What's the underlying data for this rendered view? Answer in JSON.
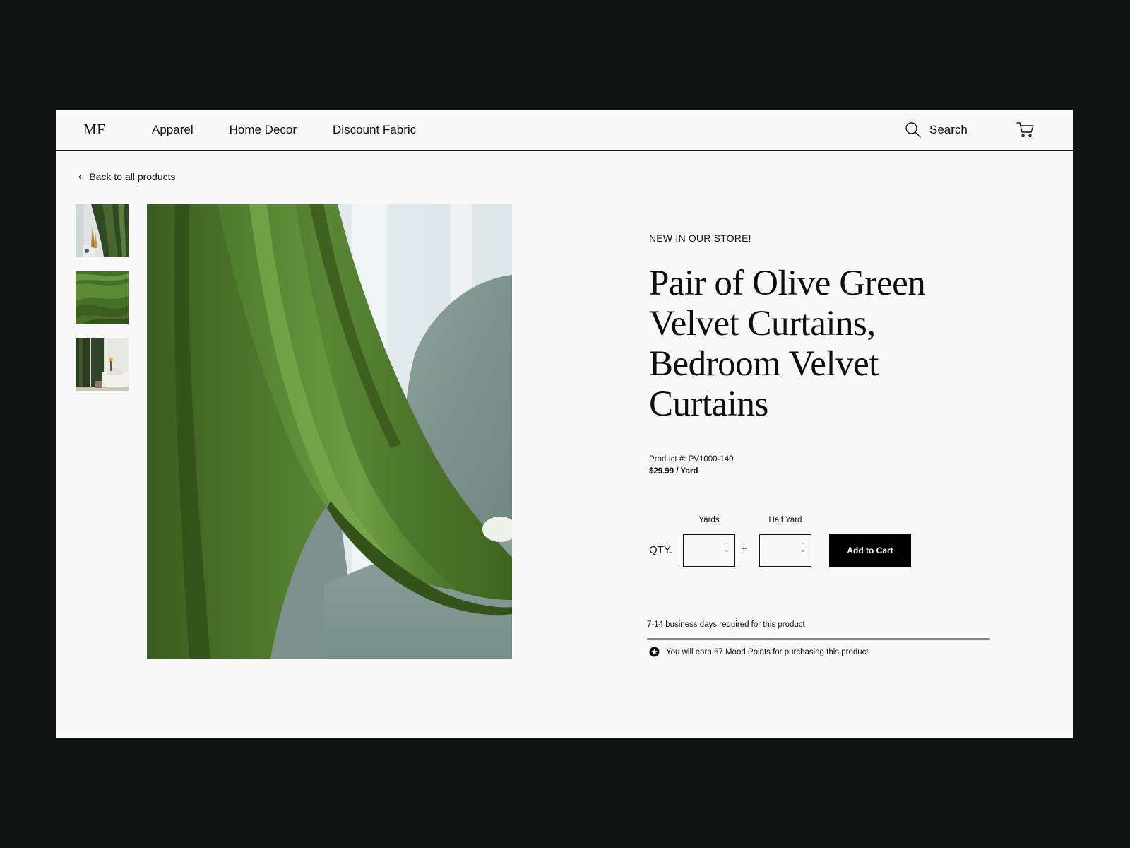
{
  "header": {
    "logo": "MF",
    "nav": [
      {
        "label": "Apparel"
      },
      {
        "label": "Home Decor"
      },
      {
        "label": "Discount Fabric"
      }
    ],
    "search_label": "Search",
    "icons": {
      "search": "search-icon",
      "cart": "cart-icon"
    }
  },
  "back_link": {
    "label": "Back to all products"
  },
  "gallery": {
    "thumbnails": [
      "curtain-room-photo",
      "velvet-fabric-closeup",
      "curtain-living-room-photo"
    ],
    "main_image": "olive-velvet-curtain-draped-over-armchair"
  },
  "product": {
    "badge": "NEW IN OUR STORE!",
    "title": "Pair of Olive Green Velvet Curtains, Bedroom Velvet Curtains",
    "sku": "Product #: PV1000-140",
    "price": "$29.99 / Yard"
  },
  "purchase": {
    "qty_label": "QTY.",
    "yards_caption": "Yards",
    "yards_value": "",
    "half_yard_caption": "Half Yard",
    "half_yard_value": "",
    "plus": "+",
    "add_to_cart": "Add to Cart"
  },
  "shipping": {
    "lead_time": "7-14 business days required for this product",
    "points": "You will earn 67 Mood Points for purchasing this product."
  },
  "colors": {
    "page_bg": "#f8f8f8",
    "outer_bg": "#111212",
    "button": "#000000",
    "velvet_green": "#4e7a2c",
    "chair_gray": "#7f9590"
  }
}
